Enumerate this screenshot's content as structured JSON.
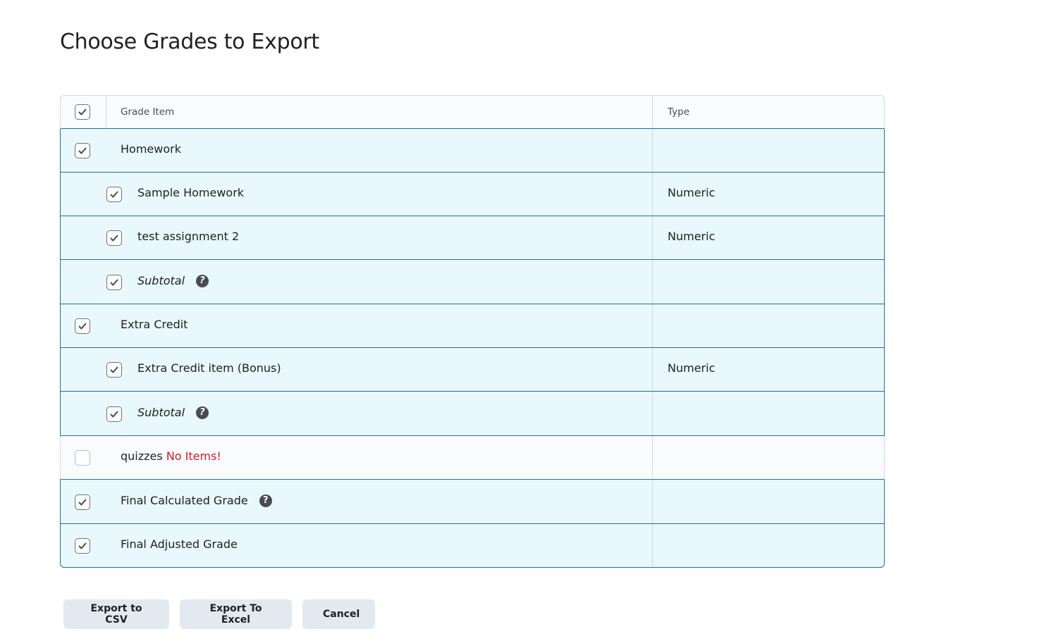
{
  "page": {
    "title": "Choose Grades to Export"
  },
  "table": {
    "headers": {
      "grade_item": "Grade Item",
      "type": "Type"
    },
    "rows": [
      {
        "label": "Homework",
        "type": "",
        "level": 0,
        "checked": true,
        "italic": false,
        "help": false
      },
      {
        "label": "Sample Homework",
        "type": "Numeric",
        "level": 1,
        "checked": true,
        "italic": false,
        "help": false
      },
      {
        "label": "test assignment 2",
        "type": "Numeric",
        "level": 1,
        "checked": true,
        "italic": false,
        "help": false
      },
      {
        "label": "Subtotal",
        "type": "",
        "level": 1,
        "checked": true,
        "italic": true,
        "help": true
      },
      {
        "label": "Extra Credit",
        "type": "",
        "level": 0,
        "checked": true,
        "italic": false,
        "help": false
      },
      {
        "label": "Extra Credit item (Bonus)",
        "type": "Numeric",
        "level": 1,
        "checked": true,
        "italic": false,
        "help": false
      },
      {
        "label": "Subtotal",
        "type": "",
        "level": 1,
        "checked": true,
        "italic": true,
        "help": true
      },
      {
        "label": "quizzes",
        "warning": "No Items!",
        "type": "",
        "level": 0,
        "checked": false,
        "italic": false,
        "help": false
      },
      {
        "label": "Final Calculated Grade",
        "type": "",
        "level": 0,
        "checked": true,
        "italic": false,
        "help": true
      },
      {
        "label": "Final Adjusted Grade",
        "type": "",
        "level": 0,
        "checked": true,
        "italic": false,
        "help": false
      }
    ]
  },
  "buttons": {
    "export_csv": "Export to CSV",
    "export_excel": "Export To Excel",
    "cancel": "Cancel"
  },
  "icons": {
    "help": "?"
  },
  "colors": {
    "selected_row_bg": "#e8f8fd",
    "row_border": "#1e6f9f",
    "warning": "#cd2026",
    "button_bg": "#e3e9f1"
  }
}
